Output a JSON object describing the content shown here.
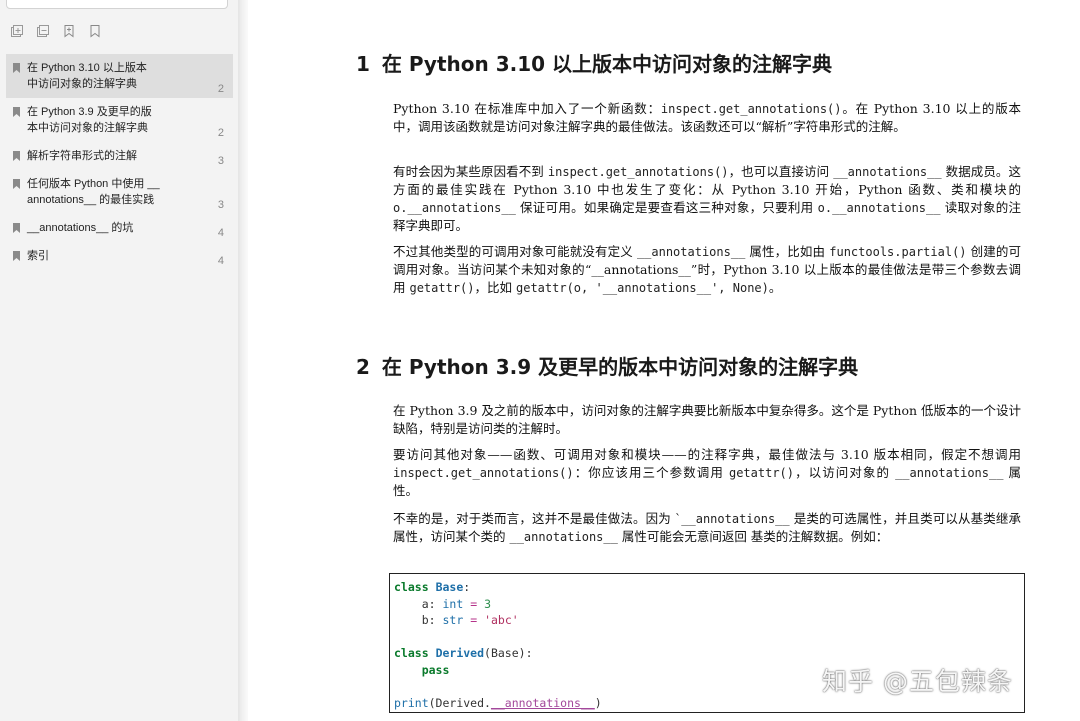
{
  "sidebar": {
    "toolbar": [
      {
        "name": "expand-all-icon"
      },
      {
        "name": "collapse-all-icon"
      },
      {
        "name": "add-bookmark-icon"
      },
      {
        "name": "bookmark-outline-icon"
      }
    ],
    "outline": [
      {
        "label": "在 Python 3.10 以上版本中访问对象的注解字典",
        "lines": [
          "在 Python 3.10 以上版本",
          "中访问对象的注解字典"
        ],
        "page": "2",
        "active": true
      },
      {
        "label": "在 Python 3.9 及更早的版本中访问对象的注解字典",
        "lines": [
          "在 Python 3.9 及更早的版",
          "本中访问对象的注解字典"
        ],
        "page": "2",
        "active": false
      },
      {
        "label": "解析字符串形式的注解",
        "lines": [
          "解析字符串形式的注解"
        ],
        "page": "3",
        "active": false
      },
      {
        "label": "任何版本 Python 中使用 __annotations__ 的最佳实践",
        "lines": [
          "任何版本 Python 中使用 __",
          "annotations__ 的最佳实践"
        ],
        "page": "3",
        "active": false
      },
      {
        "label": "__annotations__ 的坑",
        "lines": [
          "__annotations__ 的坑"
        ],
        "page": "4",
        "active": false
      },
      {
        "label": "索引",
        "lines": [
          "索引"
        ],
        "page": "4",
        "active": false
      }
    ]
  },
  "doc": {
    "s1": {
      "num": "1",
      "title": "在 Python 3.10 以上版本中访问对象的注解字典",
      "p1": [
        {
          "t": "Python 3.10 在标准库中加入了一个新函数："
        },
        {
          "c": "inspect.get_annotations()"
        },
        {
          "t": "。在 Python 3.10 以上的版本中，调用该函数就是访问对象注解字典的最佳做法。该函数还可以“解析”字符串形式的注解。"
        }
      ],
      "p2": [
        {
          "t": "有时会因为某些原因看不到 "
        },
        {
          "c": "inspect.get_annotations()"
        },
        {
          "t": "，也可以直接访问 "
        },
        {
          "c": "__annotations__"
        },
        {
          "t": " 数据成员。这方面的最佳实践在 Python 3.10 中也发生了变化：从 Python 3.10 开始，Python 函数、类和模块的 "
        },
        {
          "c": "o.__annotations__"
        },
        {
          "t": " 保证可用。如果确定是要查看这三种对象，只要利用 "
        },
        {
          "c": "o.__annotations__"
        },
        {
          "t": " 读取对象的注释字典即可。"
        }
      ],
      "p3": [
        {
          "t": "不过其他类型的可调用对象可能就没有定义 "
        },
        {
          "c": "__annotations__"
        },
        {
          "t": " 属性，比如由 "
        },
        {
          "c": "functools.partial()"
        },
        {
          "t": " 创建的可调用对象。当访问某个未知对象的“__annotations__”时，Python 3.10 以上版本的最佳做法是带三个参数去调用 "
        },
        {
          "c": "getattr()"
        },
        {
          "t": "，比如 "
        },
        {
          "c": "getattr(o, '__annotations__', None)"
        },
        {
          "t": "。"
        }
      ]
    },
    "s2": {
      "num": "2",
      "title": "在 Python 3.9 及更早的版本中访问对象的注解字典",
      "p1": [
        {
          "t": "在 Python 3.9 及之前的版本中，访问对象的注解字典要比新版本中复杂得多。这个是 Python 低版本的一个设计缺陷，特别是访问类的注解时。"
        }
      ],
      "p2": [
        {
          "t": "要访问其他对象——函数、可调用对象和模块——的注释字典，最佳做法与 3.10 版本相同，假定不想调用 "
        },
        {
          "c": "inspect.get_annotations()"
        },
        {
          "t": "：你应该用三个参数调用 "
        },
        {
          "c": "getattr()"
        },
        {
          "t": "，以访问对象的 "
        },
        {
          "c": "__annotations__"
        },
        {
          "t": " 属性。"
        }
      ],
      "p3": [
        {
          "t": "不幸的是，对于类而言，这并不是最佳做法。因为 `"
        },
        {
          "c": "__annotations__"
        },
        {
          "t": " 是类的可选属性，并且类可以从基类继承属性，访问某个类的 "
        },
        {
          "c": "__annotations__"
        },
        {
          "t": " 属性可能会无意间返回 基类的注解数据。例如："
        }
      ]
    },
    "code": [
      [
        {
          "k": "kw",
          "v": "class"
        },
        {
          "v": " "
        },
        {
          "k": "cls",
          "v": "Base"
        },
        {
          "v": ":"
        }
      ],
      [
        {
          "v": "    a: "
        },
        {
          "k": "bi",
          "v": "int"
        },
        {
          "v": " "
        },
        {
          "k": "op",
          "v": "="
        },
        {
          "v": " "
        },
        {
          "k": "numlit",
          "v": "3"
        }
      ],
      [
        {
          "v": "    b: "
        },
        {
          "k": "bi",
          "v": "str"
        },
        {
          "v": " "
        },
        {
          "k": "op",
          "v": "="
        },
        {
          "v": " "
        },
        {
          "k": "str",
          "v": "'abc'"
        }
      ],
      [],
      [
        {
          "k": "kw",
          "v": "class"
        },
        {
          "v": " "
        },
        {
          "k": "cls",
          "v": "Derived"
        },
        {
          "v": "(Base):"
        }
      ],
      [
        {
          "v": "    "
        },
        {
          "k": "kw",
          "v": "pass"
        }
      ],
      [],
      [
        {
          "k": "bi",
          "v": "print"
        },
        {
          "v": "(Derived."
        },
        {
          "k": "dunder",
          "v": "__annotations__"
        },
        {
          "v": ")"
        }
      ]
    ]
  },
  "watermark": "知乎 @五包辣条"
}
